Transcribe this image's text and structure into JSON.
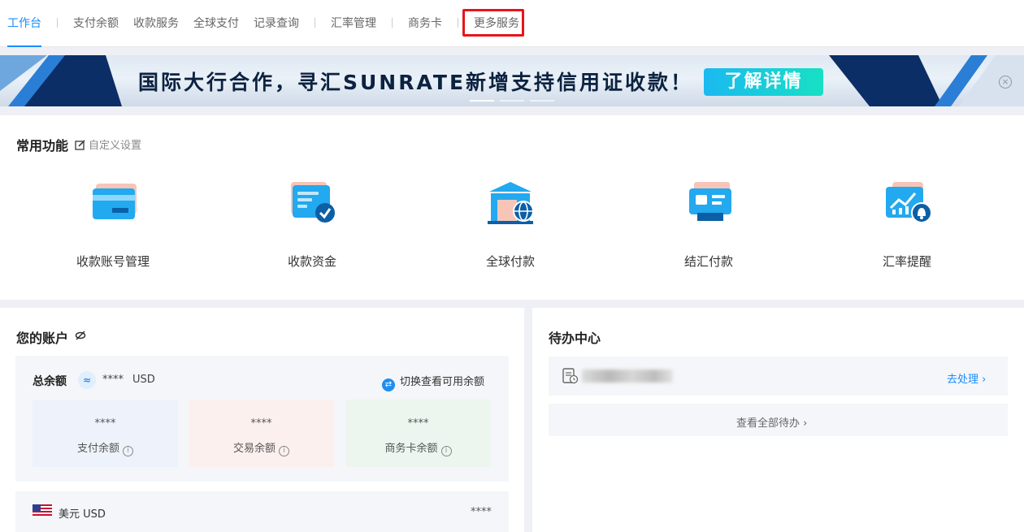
{
  "nav": {
    "items": [
      {
        "label": "工作台",
        "active": true
      },
      {
        "label": "支付余额"
      },
      {
        "label": "收款服务"
      },
      {
        "label": "全球支付"
      },
      {
        "label": "记录查询"
      },
      {
        "label": "汇率管理"
      },
      {
        "label": "商务卡"
      },
      {
        "label": "更多服务",
        "highlighted": true
      }
    ],
    "highlight_color": "#e8141b",
    "active_color": "#1a8cff"
  },
  "banner": {
    "text": "国际大行合作，寻汇SUNRATE新增支持信用证收款！",
    "cta": "了解详情",
    "close_icon": "close-circle-icon",
    "slide_count": 3,
    "active_slide": 1
  },
  "common": {
    "title": "常用功能",
    "edit_label": "自定义设置",
    "items": [
      {
        "label": "收款账号管理",
        "icon": "card-icon"
      },
      {
        "label": "收款资金",
        "icon": "funds-check-icon"
      },
      {
        "label": "全球付款",
        "icon": "bank-globe-icon"
      },
      {
        "label": "结汇付款",
        "icon": "id-card-icon"
      },
      {
        "label": "汇率提醒",
        "icon": "chart-bell-icon"
      }
    ]
  },
  "account": {
    "title": "您的账户",
    "total_label": "总余额",
    "total_value": "****",
    "currency": "USD",
    "switch_label": "切换查看可用余额",
    "cards": [
      {
        "label": "支付余额",
        "value": "****",
        "color": "#eef3fb"
      },
      {
        "label": "交易余额",
        "value": "****",
        "color": "#fcf0ee"
      },
      {
        "label": "商务卡余额",
        "value": "****",
        "color": "#ecf6ef"
      }
    ],
    "usd_row": {
      "label": "美元 USD",
      "value": "****"
    }
  },
  "todo": {
    "title": "待办中心",
    "action": "去处理",
    "view_all": "查看全部待办"
  }
}
